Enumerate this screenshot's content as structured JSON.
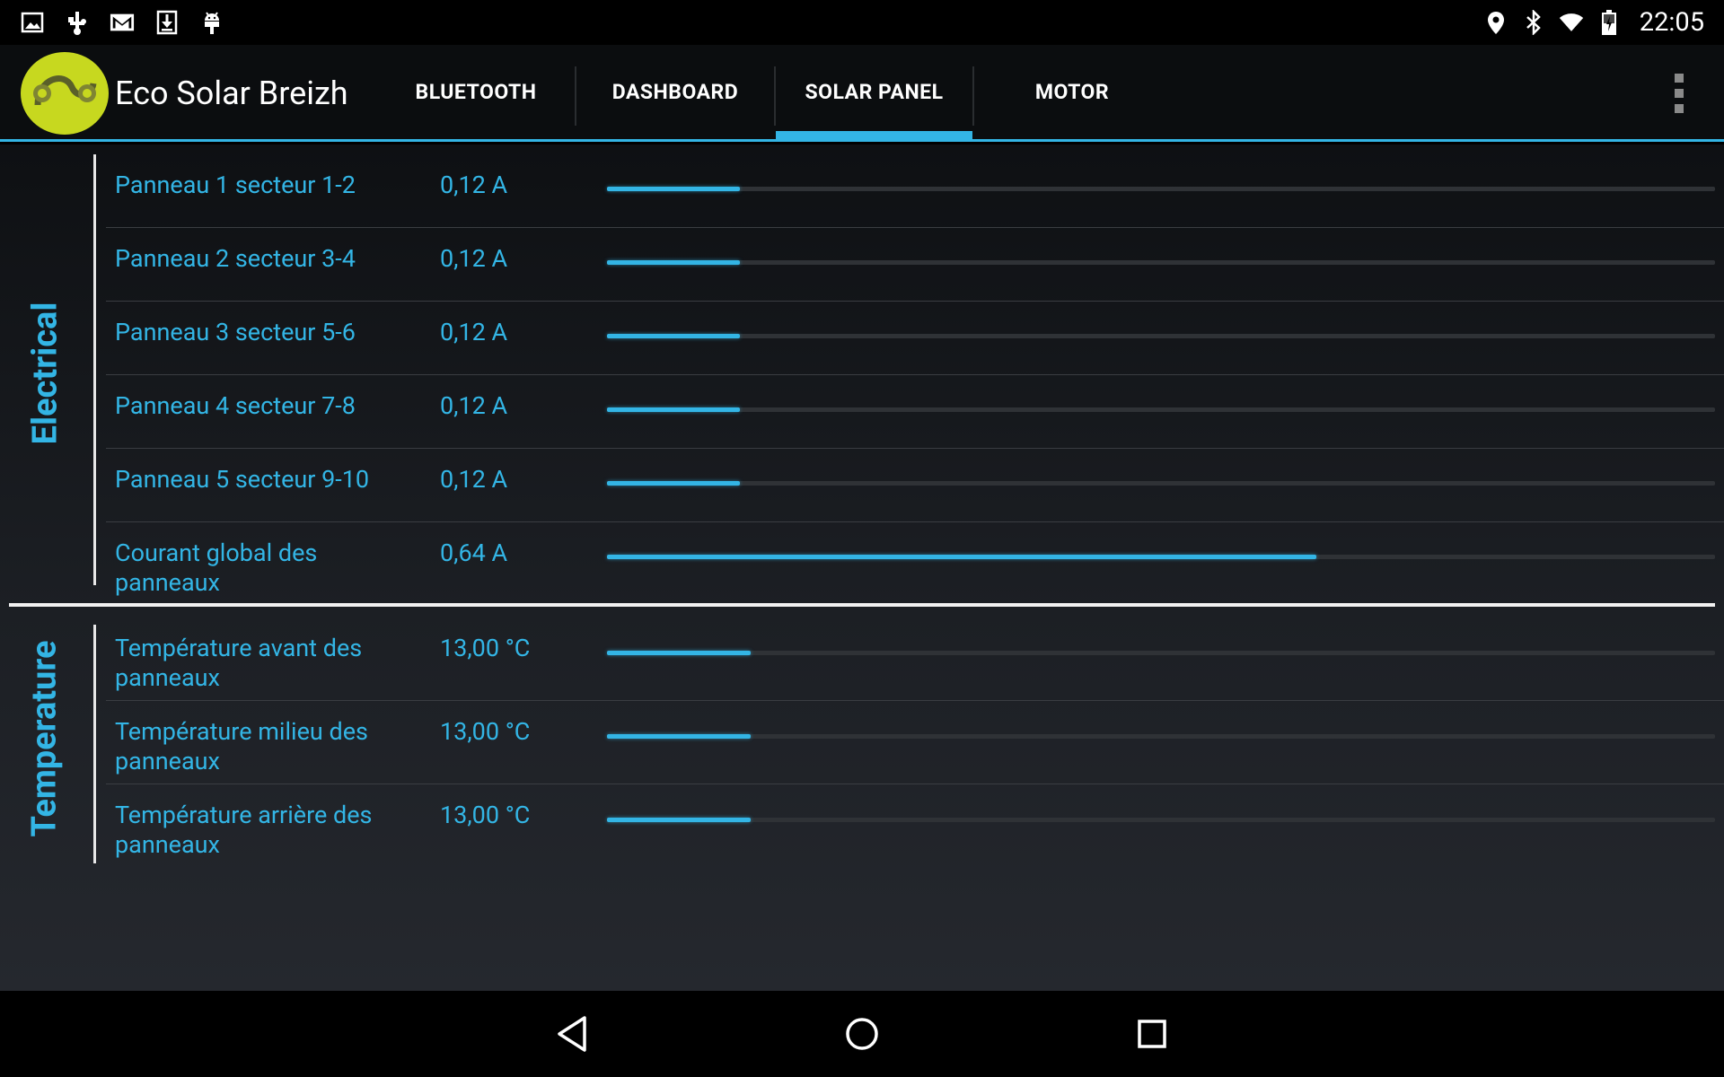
{
  "status_bar": {
    "time": "22:05",
    "left_icons": [
      "image-icon",
      "usb-icon",
      "gmail-icon",
      "download-icon",
      "android-debug-icon"
    ],
    "right_icons": [
      "location-icon",
      "bluetooth-icon",
      "wifi-icon",
      "battery-charging-icon"
    ]
  },
  "action_bar": {
    "app_title": "Eco Solar Breizh",
    "logo_icon": "eco-solar-logo-icon",
    "tabs": [
      {
        "label": "BLUETOOTH",
        "selected": false
      },
      {
        "label": "DASHBOARD",
        "selected": false
      },
      {
        "label": "SOLAR PANEL",
        "selected": true
      },
      {
        "label": "MOTOR",
        "selected": false
      }
    ],
    "overflow_icon": "more-vert-icon",
    "accent_color": "#33b5e5"
  },
  "sections": [
    {
      "title": "Electrical",
      "rows": [
        {
          "label": "Panneau 1 secteur 1-2",
          "value": "0,12 A",
          "level": 0.12
        },
        {
          "label": "Panneau 2 secteur 3-4",
          "value": "0,12 A",
          "level": 0.12
        },
        {
          "label": "Panneau 3 secteur 5-6",
          "value": "0,12 A",
          "level": 0.12
        },
        {
          "label": "Panneau 4 secteur 7-8",
          "value": "0,12 A",
          "level": 0.12
        },
        {
          "label": "Panneau 5 secteur 9-10",
          "value": "0,12 A",
          "level": 0.12
        },
        {
          "label": "Courant global des panneaux",
          "value": "0,64 A",
          "level": 0.64
        }
      ]
    },
    {
      "title": "Temperature",
      "rows": [
        {
          "label": "Température avant des panneaux",
          "value": "13,00 °C",
          "level": 0.13
        },
        {
          "label": "Température milieu des panneaux",
          "value": "13,00 °C",
          "level": 0.13
        },
        {
          "label": "Température arrière des panneaux",
          "value": "13,00 °C",
          "level": 0.13
        }
      ]
    }
  ],
  "nav_bar": {
    "buttons": [
      "back-icon",
      "home-icon",
      "recents-icon"
    ]
  }
}
